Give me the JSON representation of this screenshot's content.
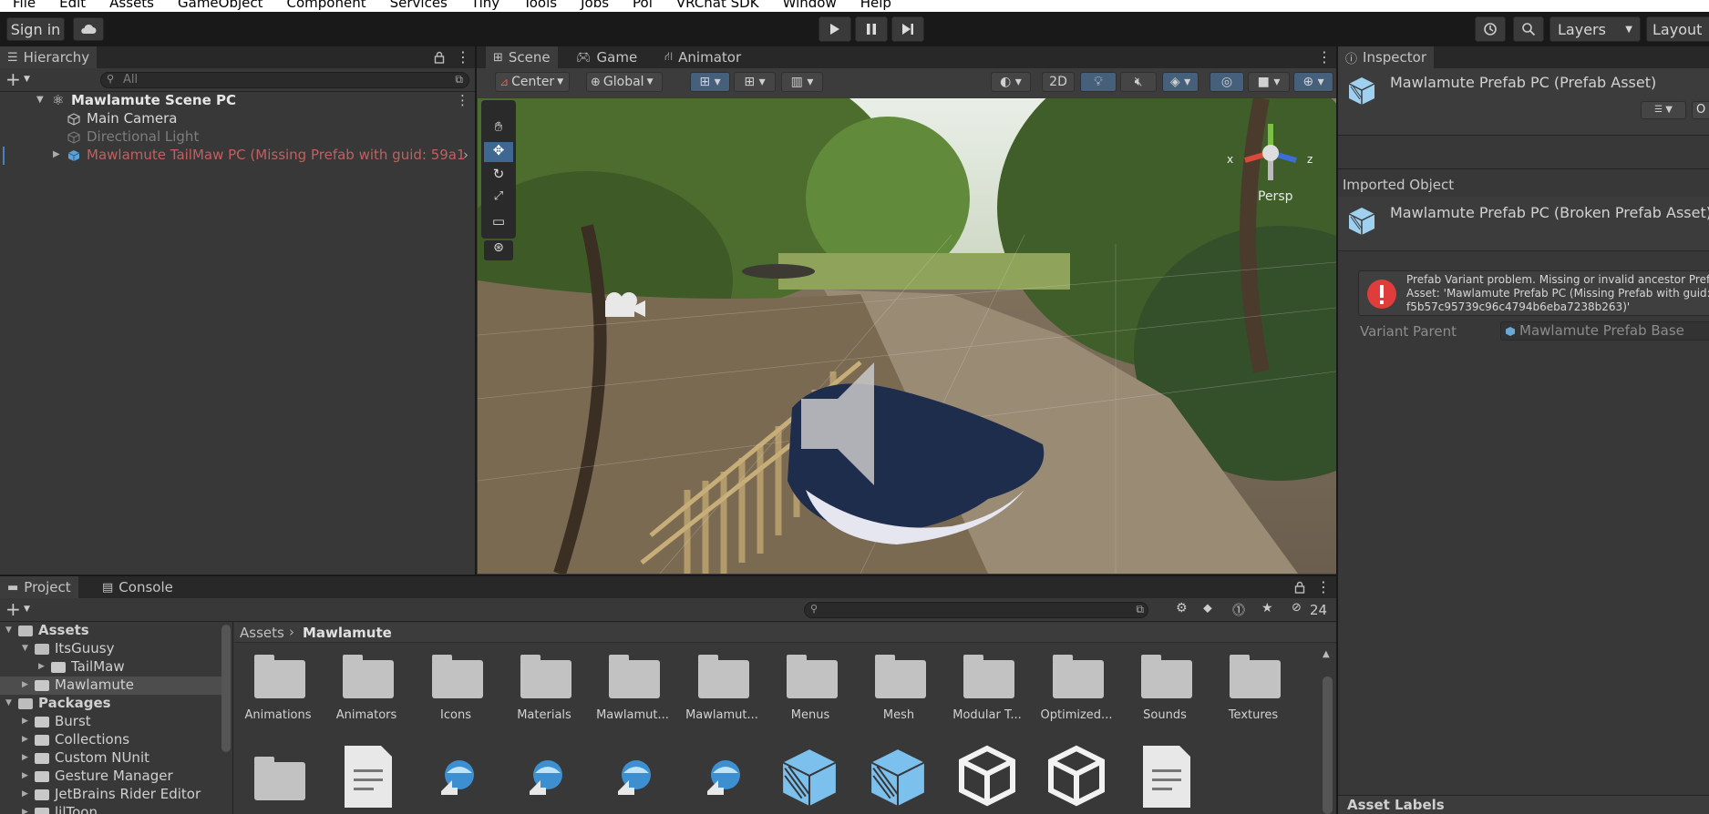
{
  "menu": [
    "File",
    "Edit",
    "Assets",
    "GameObject",
    "Component",
    "Services",
    "Tiny",
    "Tools",
    "Jobs",
    "Poi",
    "VRChat SDK",
    "Window",
    "Help"
  ],
  "toolbar": {
    "sign_in": "Sign in",
    "layers": "Layers",
    "layout": "Layout"
  },
  "hierarchy": {
    "tab": "Hierarchy",
    "search_placeholder": "All",
    "scene": "Mawlamute Scene PC",
    "items": [
      "Main Camera",
      "Directional Light",
      "Mawlamute TailMaw PC (Missing Prefab with guid: 59a1"
    ]
  },
  "scene_view": {
    "tabs": [
      "Scene",
      "Game",
      "Animator"
    ],
    "pivot": "Center",
    "space": "Global",
    "mode_2d": "2D",
    "persp": "Persp",
    "gizmo_x": "x",
    "gizmo_z": "z"
  },
  "inspector": {
    "tab": "Inspector",
    "title": "Mawlamute Prefab PC (Prefab Asset)",
    "open_btn": "O",
    "imported_header": "Imported Object",
    "imported_name": "Mawlamute Prefab PC (Broken Prefab Asset)",
    "error_lines": [
      "Prefab Variant problem. Missing or invalid ancestor Prefa",
      "Asset: 'Mawlamute Prefab PC (Missing Prefab with guid:",
      "f5b57c95739c96c4794b6eba7238b263)'"
    ],
    "variant_label": "Variant Parent",
    "variant_value": "Mawlamute Prefab Base",
    "asset_labels": "Asset Labels"
  },
  "project": {
    "tabs": [
      "Project",
      "Console"
    ],
    "hidden_count": "24",
    "breadcrumb_root": "Assets",
    "breadcrumb_current": "Mawlamute",
    "tree": [
      {
        "label": "Assets",
        "level": 0,
        "bold": true
      },
      {
        "label": "ItsGuusy",
        "level": 1
      },
      {
        "label": "TailMaw",
        "level": 2
      },
      {
        "label": "Mawlamute",
        "level": 1,
        "selected": true
      },
      {
        "label": "Packages",
        "level": 0,
        "bold": true
      },
      {
        "label": "Burst",
        "level": 1
      },
      {
        "label": "Collections",
        "level": 1
      },
      {
        "label": "Custom NUnit",
        "level": 1
      },
      {
        "label": "Gesture Manager",
        "level": 1
      },
      {
        "label": "JetBrains Rider Editor",
        "level": 1
      },
      {
        "label": "lilToon",
        "level": 1
      }
    ],
    "folders": [
      "Animations",
      "Animators",
      "Icons",
      "Materials",
      "Mawlamut...",
      "Mawlamut...",
      "Menus",
      "Mesh",
      "Modular T...",
      "Optimized...",
      "Sounds",
      "Textures"
    ]
  },
  "colors": {
    "accent": "#2c5d87",
    "error": "#e03c3c",
    "missing": "#c35f5f",
    "selected": "#4d4d4d"
  }
}
